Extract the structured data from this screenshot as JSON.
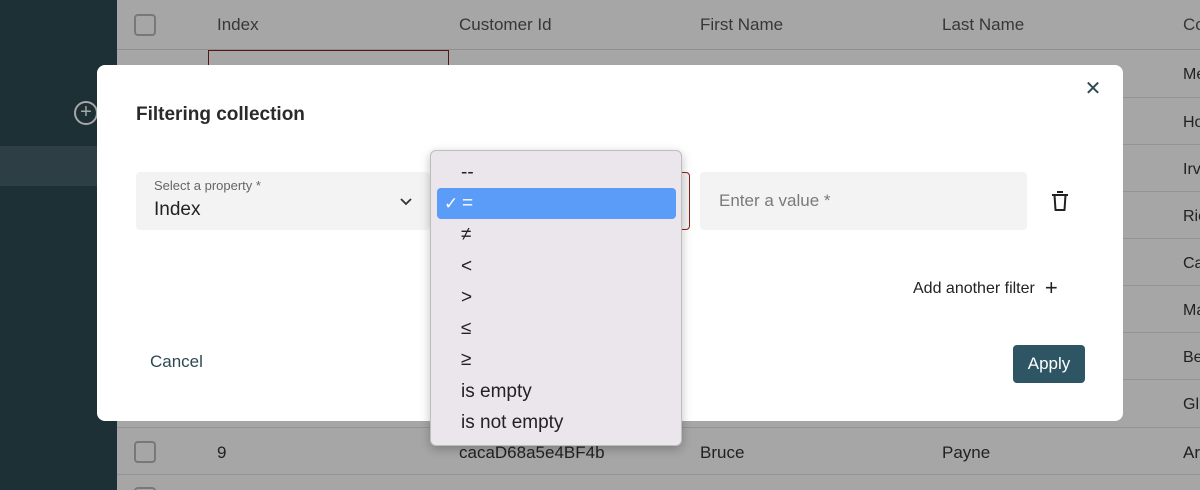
{
  "table": {
    "columns": [
      "Index",
      "Customer Id",
      "First Name",
      "Last Name",
      "Co"
    ],
    "right_column_cells": [
      "Me",
      "Ho",
      "Irv",
      "Ric",
      "Ca",
      "Ma",
      "Be",
      "Gl"
    ],
    "visible_row": {
      "index": "9",
      "customer_id": "cacaD68a5e4BF4b",
      "first_name": "Bruce",
      "last_name": "Payne",
      "company": "Ar"
    }
  },
  "modal": {
    "title": "Filtering collection",
    "close_icon": "close-icon",
    "property_select": {
      "label": "Select a property *",
      "value": "Index"
    },
    "value_input": {
      "placeholder": "Enter a value *",
      "value": ""
    },
    "add_filter_label": "Add another filter",
    "cancel_label": "Cancel",
    "apply_label": "Apply"
  },
  "operator_dropdown": {
    "options": [
      "--",
      "=",
      "≠",
      "<",
      ">",
      "≤",
      "≥",
      "is empty",
      "is not empty"
    ],
    "selected": "=",
    "check_mark": "✓"
  },
  "colors": {
    "sidebar": "#2d4a53",
    "accent": "#2d5563",
    "selected_option": "#5b9cf8"
  }
}
